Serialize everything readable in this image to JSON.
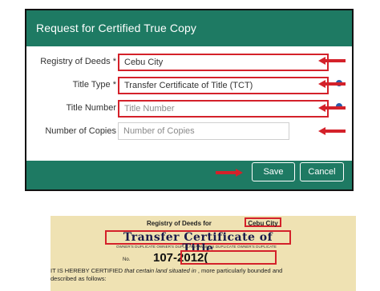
{
  "dialog": {
    "title": "Request for Certified True Copy",
    "fields": {
      "registry": {
        "label": "Registry of Deeds *",
        "value": "Cebu City"
      },
      "title_type": {
        "label": "Title Type *",
        "value": "Transfer Certificate of Title (TCT)"
      },
      "title_number": {
        "label": "Title Number",
        "placeholder": "Title Number"
      },
      "copies": {
        "label": "Number of Copies",
        "placeholder": "Number of Copies"
      }
    },
    "buttons": {
      "save": "Save",
      "cancel": "Cancel"
    }
  },
  "certificate": {
    "registry_prefix": "Registry of Deeds for",
    "registry_city": "Cebu City",
    "title": "Transfer Certificate of Title",
    "duplicate_text": "OWNER'S DUPLICATE OWNER'S DUPLICATE OWNER'S DUPLICATE OWNER'S DUPLICATE",
    "no_label": "No.",
    "number": "107-2012(",
    "body_prefix": "IT IS HEREBY CERTIFIED",
    "body_italic": " that certain land situated in",
    "body_rest": " , more particularly bounded and",
    "body_line2": "described as follows:"
  },
  "colors": {
    "header": "#1e7a63",
    "highlight": "#d4212a",
    "paper": "#efe2b3"
  }
}
